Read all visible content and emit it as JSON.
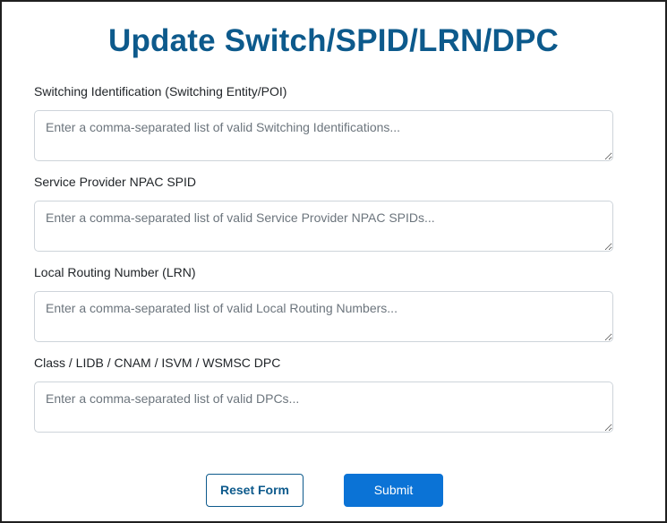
{
  "page": {
    "title": "Update Switch/SPID/LRN/DPC"
  },
  "fields": [
    {
      "label": "Switching Identification (Switching Entity/POI)",
      "placeholder": "Enter a comma-separated list of valid Switching Identifications...",
      "value": ""
    },
    {
      "label": "Service Provider NPAC SPID",
      "placeholder": "Enter a comma-separated list of valid Service Provider NPAC SPIDs...",
      "value": ""
    },
    {
      "label": "Local Routing Number (LRN)",
      "placeholder": "Enter a comma-separated list of valid Local Routing Numbers...",
      "value": ""
    },
    {
      "label": "Class / LIDB / CNAM / ISVM / WSMSC DPC",
      "placeholder": "Enter a comma-separated list of valid DPCs...",
      "value": ""
    }
  ],
  "actions": {
    "reset_label": "Reset Form",
    "submit_label": "Submit"
  },
  "colors": {
    "title": "#0d5a8c",
    "primary": "#0b73d6",
    "border": "#ced4da",
    "placeholder": "#6c757d"
  }
}
